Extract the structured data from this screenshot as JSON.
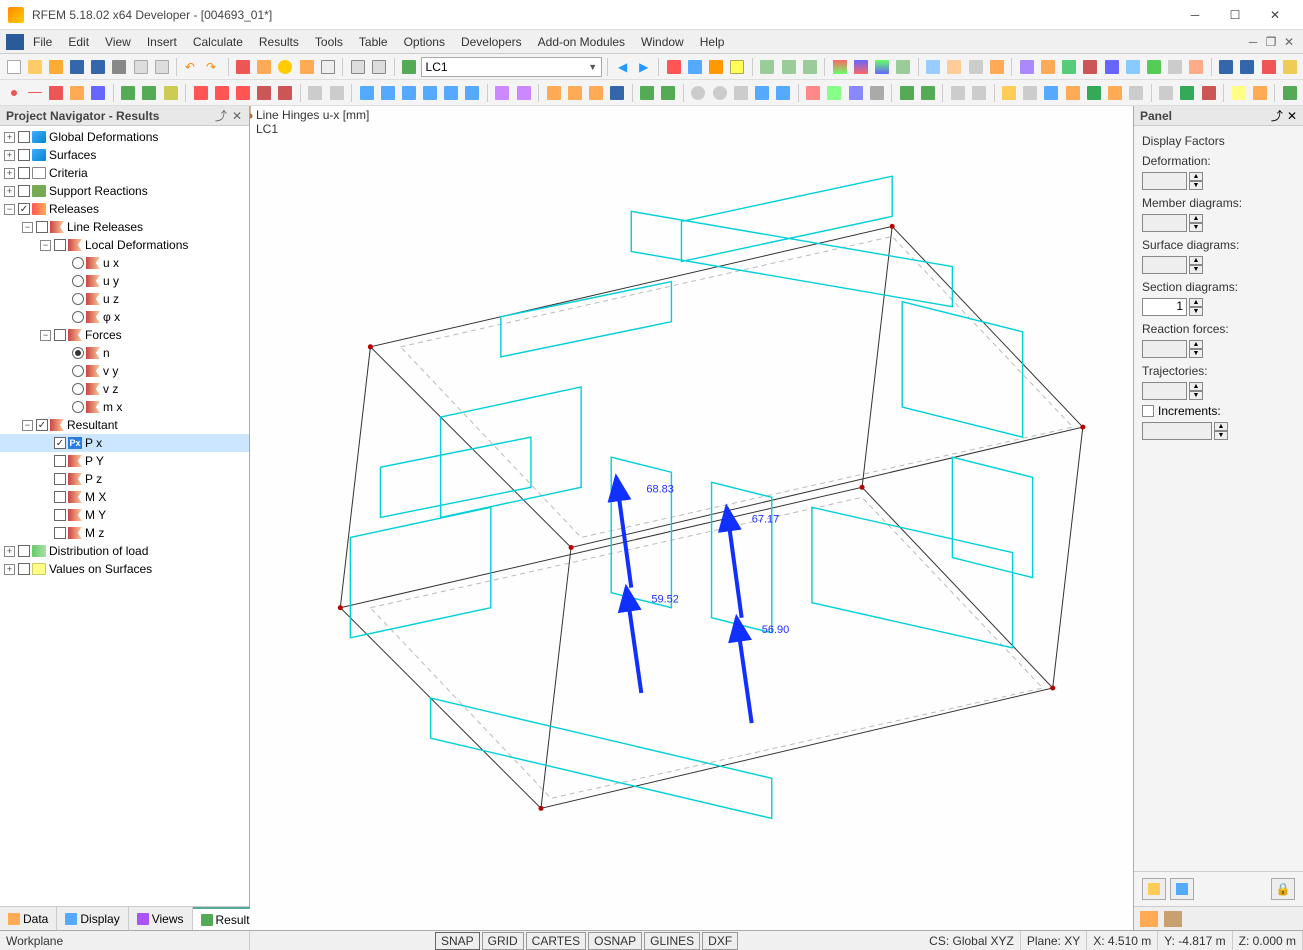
{
  "app_title": "RFEM 5.18.02 x64 Developer - [004693_01*]",
  "menu": [
    "File",
    "Edit",
    "View",
    "Insert",
    "Calculate",
    "Results",
    "Tools",
    "Table",
    "Options",
    "Developers",
    "Add-on Modules",
    "Window",
    "Help"
  ],
  "lc_combo": "LC1",
  "navigator": {
    "title": "Project Navigator - Results",
    "tabs": [
      "Data",
      "Display",
      "Views",
      "Results"
    ],
    "active_tab": 3,
    "tree": {
      "global_def": "Global Deformations",
      "surfaces": "Surfaces",
      "criteria": "Criteria",
      "supp": "Support Reactions",
      "releases": "Releases",
      "line_rel": "Line Releases",
      "local_def": "Local Deformations",
      "ux": "u x",
      "uy": "u y",
      "uz": "u z",
      "phix": "φ x",
      "forces": "Forces",
      "n": "n",
      "vy": "v y",
      "vz": "v z",
      "mx": "m x",
      "resultant": "Resultant",
      "px": "P x",
      "py": "P Y",
      "pz": "P z",
      "mmx": "M X",
      "mmy": "M Y",
      "mmz": "M z",
      "dist": "Distribution of load",
      "vals": "Values on Surfaces"
    }
  },
  "viewport": {
    "line1": "Line Hinges u-x [mm]",
    "line2": "LC1",
    "values": {
      "v1": "68.83",
      "v2": "67.17",
      "v3": "59.52",
      "v4": "56.90"
    }
  },
  "panel": {
    "title": "Panel",
    "section_title": "Display Factors",
    "deformation": "Deformation:",
    "member": "Member diagrams:",
    "surface": "Surface diagrams:",
    "section": "Section diagrams:",
    "section_val": "1",
    "reaction": "Reaction forces:",
    "traj": "Trajectories:",
    "inc": "Increments:"
  },
  "status": {
    "workplane": "Workplane",
    "snap": "SNAP",
    "grid": "GRID",
    "cartes": "CARTES",
    "osnap": "OSNAP",
    "glines": "GLINES",
    "dxf": "DXF",
    "cs": "CS: Global XYZ",
    "plane": "Plane: XY",
    "x": "X: 4.510 m",
    "y": "Y: -4.817 m",
    "z": "Z: 0.000 m"
  }
}
